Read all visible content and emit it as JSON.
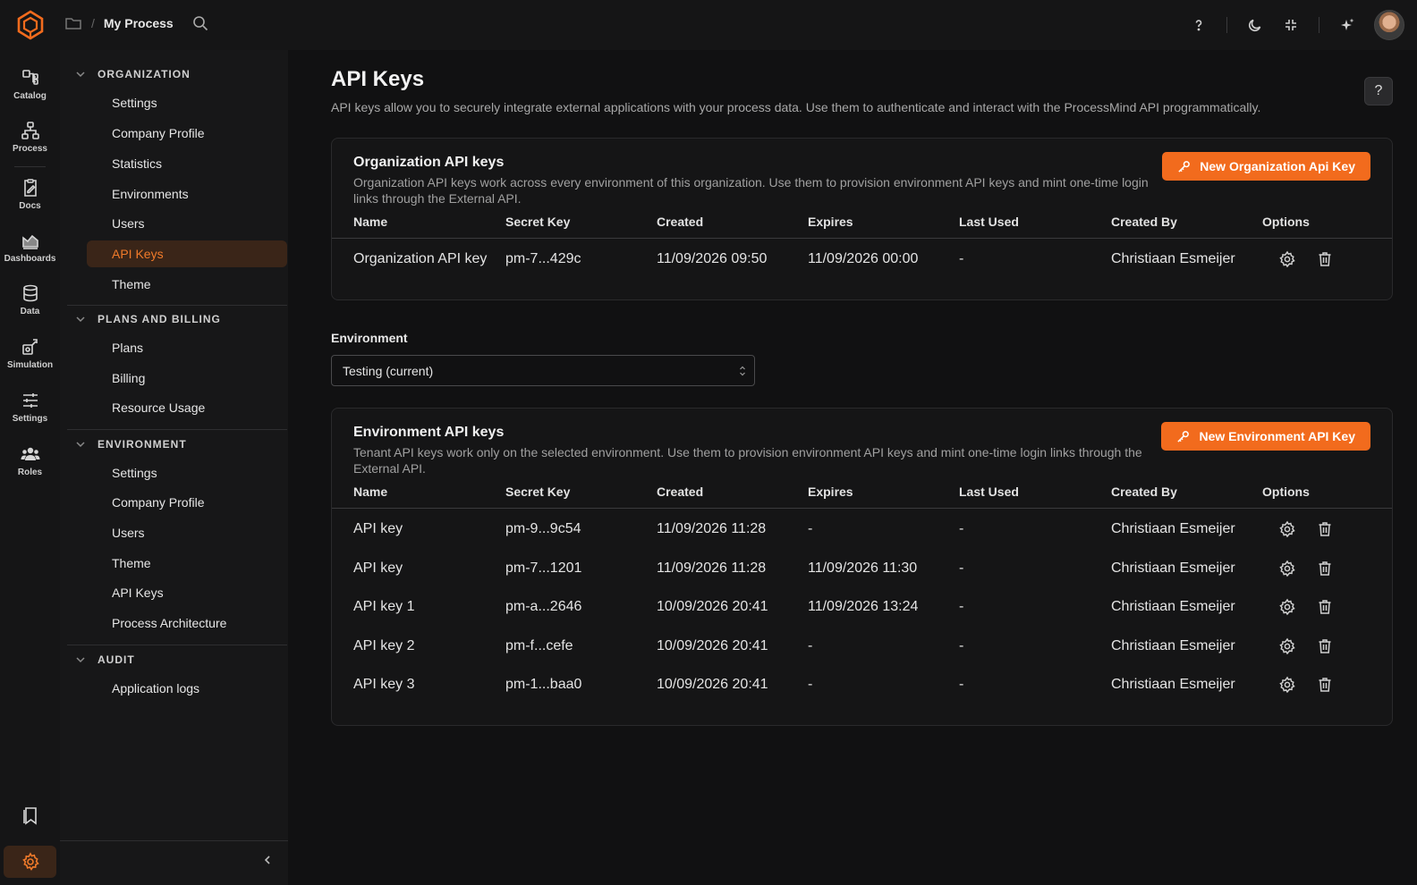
{
  "topbar": {
    "breadcrumb_sep": "/",
    "breadcrumb_title": "My Process",
    "icons": [
      "help-icon",
      "moon-icon",
      "collapse-icon",
      "sparkle-icon"
    ]
  },
  "rail": {
    "items": [
      {
        "label": "Catalog",
        "icon": "catalog-icon"
      },
      {
        "label": "Process",
        "icon": "process-icon"
      },
      {
        "label": "Docs",
        "icon": "docs-icon"
      },
      {
        "label": "Dashboards",
        "icon": "dashboards-icon"
      },
      {
        "label": "Data",
        "icon": "data-icon"
      },
      {
        "label": "Simulation",
        "icon": "simulation-icon"
      },
      {
        "label": "Settings",
        "icon": "sliders-icon"
      },
      {
        "label": "Roles",
        "icon": "roles-icon"
      }
    ]
  },
  "nav": {
    "sections": [
      {
        "label": "ORGANIZATION",
        "items": [
          "Settings",
          "Company Profile",
          "Statistics",
          "Environments",
          "Users",
          "API Keys",
          "Theme"
        ]
      },
      {
        "label": "PLANS AND BILLING",
        "items": [
          "Plans",
          "Billing",
          "Resource Usage"
        ]
      },
      {
        "label": "ENVIRONMENT",
        "items": [
          "Settings",
          "Company Profile",
          "Users",
          "Theme",
          "API Keys",
          "Process Architecture"
        ]
      },
      {
        "label": "AUDIT",
        "items": [
          "Application logs"
        ]
      }
    ],
    "active_item": "API Keys"
  },
  "main": {
    "title": "API Keys",
    "description": "API keys allow you to securely integrate external applications with your process data. Use them to authenticate and interact with the ProcessMind API programmatically.",
    "help_label": "?"
  },
  "org_card": {
    "title": "Organization API keys",
    "description": "Organization API keys work across every environment of this organization. Use them to provision environment API keys and mint one-time login links through the External API.",
    "button_label": "New Organization Api Key",
    "columns": [
      "Name",
      "Secret Key",
      "Created",
      "Expires",
      "Last Used",
      "Created By",
      "Options"
    ],
    "rows": [
      [
        "Organization API key",
        "pm-7...429c",
        "11/09/2026 09:50",
        "11/09/2026 00:00",
        "-",
        "Christiaan Esmeijer"
      ]
    ]
  },
  "environment": {
    "label": "Environment",
    "selected": "Testing (current)"
  },
  "env_card": {
    "title": "Environment API keys",
    "description": "Tenant API keys work only on the selected environment. Use them to provision environment API keys and mint one-time login links through the External API.",
    "button_label": "New Environment API Key",
    "columns": [
      "Name",
      "Secret Key",
      "Created",
      "Expires",
      "Last Used",
      "Created By",
      "Options"
    ],
    "rows": [
      [
        "API key",
        "pm-9...9c54",
        "11/09/2026 11:28",
        "-",
        "-",
        "Christiaan Esmeijer"
      ],
      [
        "API key",
        "pm-7...1201",
        "11/09/2026 11:28",
        "11/09/2026 11:30",
        "-",
        "Christiaan Esmeijer"
      ],
      [
        "API key 1",
        "pm-a...2646",
        "10/09/2026 20:41",
        "11/09/2026 13:24",
        "-",
        "Christiaan Esmeijer"
      ],
      [
        "API key 2",
        "pm-f...cefe",
        "10/09/2026 20:41",
        "-",
        "-",
        "Christiaan Esmeijer"
      ],
      [
        "API key 3",
        "pm-1...baa0",
        "10/09/2026 20:41",
        "-",
        "-",
        "Christiaan Esmeijer"
      ]
    ]
  },
  "colors": {
    "accent": "#f26b1d",
    "background": "#111112",
    "active_nav_bg": "#3a2518"
  }
}
